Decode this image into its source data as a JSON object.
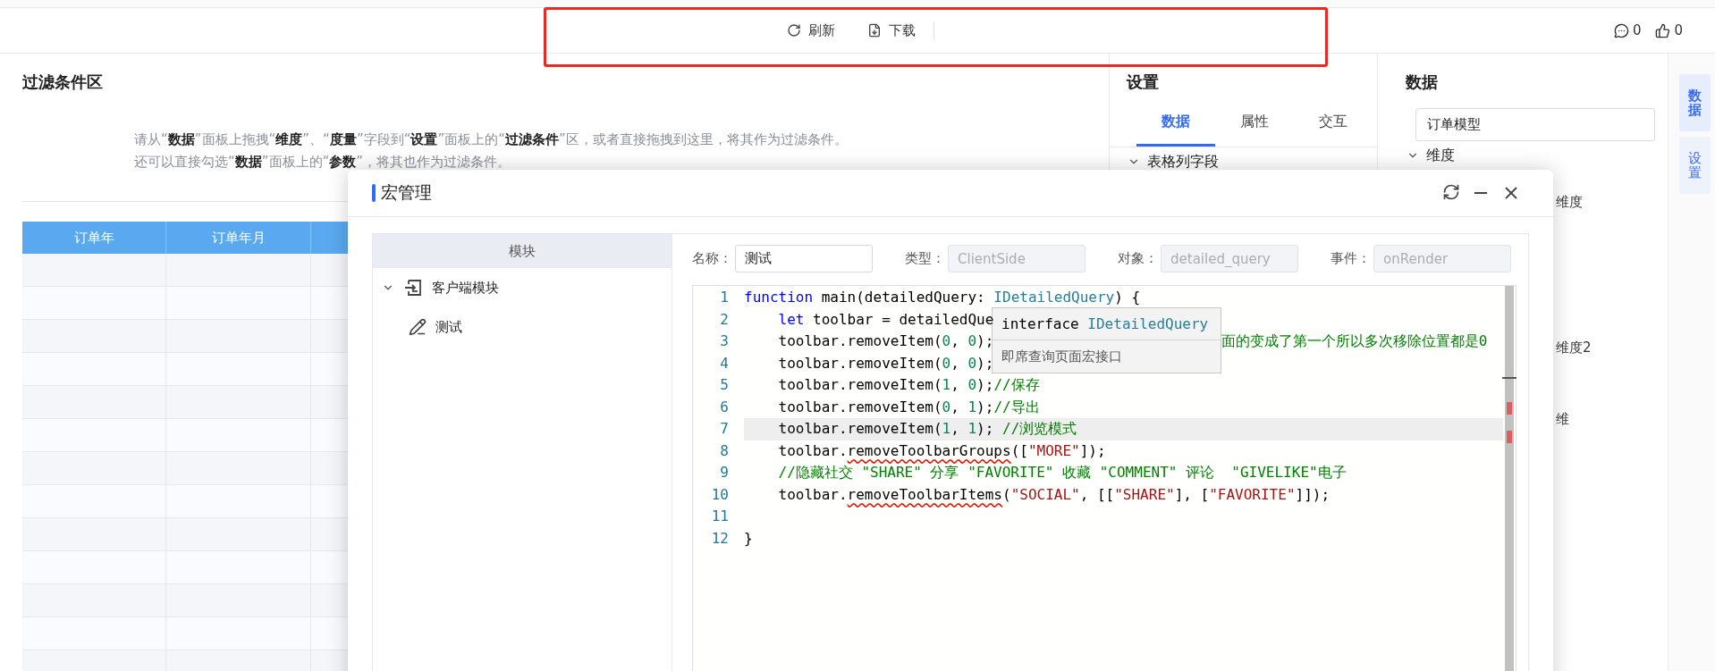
{
  "toolbar": {
    "actions": [
      {
        "label": "刷新"
      },
      {
        "label": "下载"
      }
    ],
    "counters": [
      {
        "kind": "comment",
        "count": "0"
      },
      {
        "kind": "like",
        "count": "0"
      }
    ]
  },
  "filter_area": {
    "title": "过滤条件区",
    "hint_lines": [
      "请从“**数据**”面板上拖拽“**维度**”、“**度量**”字段到“**设置**”面板上的“**过滤条件**”区，或者直接拖拽到这里，将其作为过滤条件。",
      "还可以直接勾选“**数据**”面板上的“**参数**”，将其也作为过滤条件。"
    ]
  },
  "table": {
    "columns": [
      "订单年",
      "订单年月"
    ]
  },
  "settings": {
    "title": "设置",
    "tabs": [
      {
        "label": "数据",
        "selected": true
      },
      {
        "label": "属性",
        "selected": false
      },
      {
        "label": "交互",
        "selected": false
      }
    ],
    "section": {
      "label": "表格列字段",
      "expanded": true
    }
  },
  "data_panel": {
    "title": "数据",
    "model": "订单模型",
    "group": {
      "label": "维度",
      "expanded": true
    },
    "fields": [
      {
        "label": "维度"
      },
      {
        "label": "维度2"
      },
      {
        "label": "维"
      }
    ]
  },
  "side_tabs": [
    {
      "label": "数据",
      "selected": true
    },
    {
      "label": "设置",
      "selected": false
    }
  ],
  "dialog": {
    "title": "宏管理",
    "tree_header": "模块",
    "tree": [
      {
        "label": "客户端模块",
        "expanded": true,
        "children": [
          {
            "label": "测试"
          }
        ]
      }
    ],
    "form": [
      {
        "label": "名称：",
        "value": "测试",
        "disabled": false
      },
      {
        "label": "类型：",
        "value": "ClientSide",
        "disabled": true
      },
      {
        "label": "对象：",
        "value": "detailed_query",
        "disabled": true
      },
      {
        "label": "事件：",
        "value": "onRender",
        "disabled": true
      }
    ],
    "code_lines": [
      {
        "number": "1",
        "current": false,
        "tokens": [
          {
            "kind": "keyword",
            "text": "function"
          },
          {
            "kind": "plain",
            "text": " main(detailedQuery: "
          },
          {
            "kind": "type",
            "text": "IDetailedQuery"
          },
          {
            "kind": "plain",
            "text": ") {"
          }
        ]
      },
      {
        "number": "2",
        "current": false,
        "tokens": [
          {
            "kind": "keyword",
            "text": "    let"
          },
          {
            "kind": "plain",
            "text": " toolbar = detailedQue"
          }
        ]
      },
      {
        "number": "3",
        "current": false,
        "tokens": [
          {
            "kind": "plain",
            "text": "    toolbar.removeItem("
          },
          {
            "kind": "number",
            "text": "0"
          },
          {
            "kind": "plain",
            "text": ", "
          },
          {
            "kind": "number",
            "text": "0"
          },
          {
            "kind": "plain",
            "text": ");"
          }
        ],
        "tail": "面的变成了第一个所以多次移除位置都是0"
      },
      {
        "number": "4",
        "current": false,
        "tokens": [
          {
            "kind": "plain",
            "text": "    toolbar.removeItem("
          },
          {
            "kind": "number",
            "text": "0"
          },
          {
            "kind": "plain",
            "text": ", "
          },
          {
            "kind": "number",
            "text": "0"
          },
          {
            "kind": "plain",
            "text": ");"
          }
        ]
      },
      {
        "number": "5",
        "current": false,
        "tokens": [
          {
            "kind": "plain",
            "text": "    toolbar.removeItem("
          },
          {
            "kind": "number",
            "text": "1"
          },
          {
            "kind": "plain",
            "text": ", "
          },
          {
            "kind": "number",
            "text": "0"
          },
          {
            "kind": "plain",
            "text": ");"
          },
          {
            "kind": "comment",
            "text": "//保存"
          }
        ]
      },
      {
        "number": "6",
        "current": false,
        "tokens": [
          {
            "kind": "plain",
            "text": "    toolbar.removeItem("
          },
          {
            "kind": "number",
            "text": "0"
          },
          {
            "kind": "plain",
            "text": ", "
          },
          {
            "kind": "number",
            "text": "1"
          },
          {
            "kind": "plain",
            "text": ");"
          },
          {
            "kind": "comment",
            "text": "//导出"
          }
        ]
      },
      {
        "number": "7",
        "current": true,
        "tokens": [
          {
            "kind": "plain",
            "text": "    toolbar.removeItem("
          },
          {
            "kind": "number",
            "text": "1"
          },
          {
            "kind": "plain",
            "text": ", "
          },
          {
            "kind": "number",
            "text": "1"
          },
          {
            "kind": "plain",
            "text": "); "
          },
          {
            "kind": "comment",
            "text": "//浏览模式"
          }
        ]
      },
      {
        "number": "8",
        "current": false,
        "tokens": [
          {
            "kind": "plain",
            "text": "    toolbar."
          },
          {
            "kind": "error",
            "text": "removeToolbarGroups"
          },
          {
            "kind": "plain",
            "text": "(["
          },
          {
            "kind": "string",
            "text": "\"MORE\""
          },
          {
            "kind": "plain",
            "text": "]);"
          }
        ]
      },
      {
        "number": "9",
        "current": false,
        "tokens": [
          {
            "kind": "comment",
            "text": "    //隐藏社交 \"SHARE\" 分享 \"FAVORITE\" 收藏 \"COMMENT\" 评论  \"GIVELIKE\"电子"
          }
        ]
      },
      {
        "number": "10",
        "current": false,
        "tokens": [
          {
            "kind": "plain",
            "text": "    toolbar."
          },
          {
            "kind": "error",
            "text": "removeToolbarItems"
          },
          {
            "kind": "plain",
            "text": "("
          },
          {
            "kind": "string",
            "text": "\"SOCIAL\""
          },
          {
            "kind": "plain",
            "text": ", [["
          },
          {
            "kind": "string",
            "text": "\"SHARE\""
          },
          {
            "kind": "plain",
            "text": "], ["
          },
          {
            "kind": "string",
            "text": "\"FAVORITE\""
          },
          {
            "kind": "plain",
            "text": "]]);"
          }
        ]
      },
      {
        "number": "11",
        "current": false
      },
      {
        "number": "12",
        "current": false,
        "tokens": [
          {
            "kind": "plain",
            "text": "}"
          }
        ]
      }
    ],
    "tooltip": {
      "keyword": "interface",
      "type": "IDetailedQuery",
      "description": "即席查询页面宏接口"
    }
  }
}
